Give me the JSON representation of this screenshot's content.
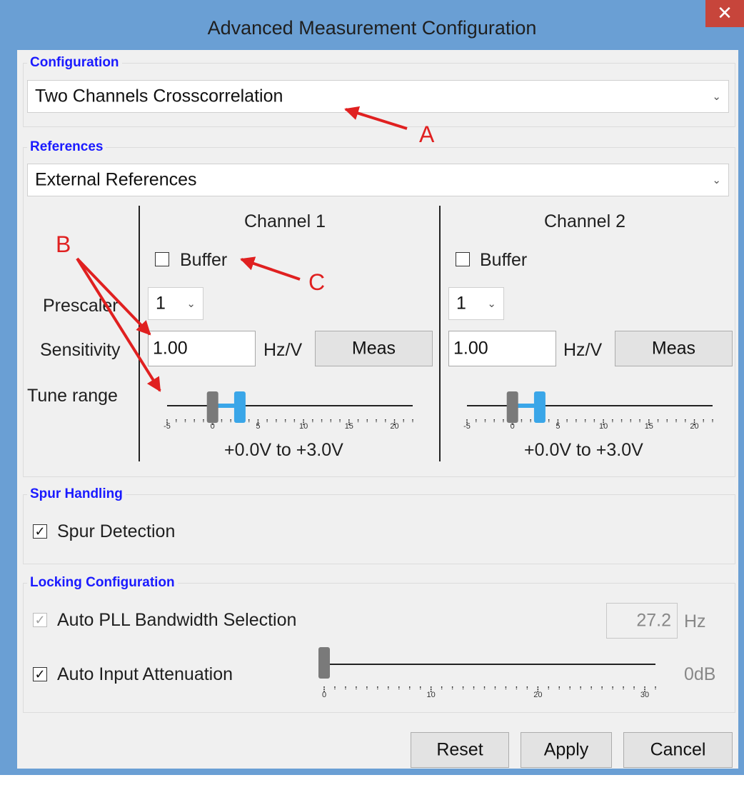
{
  "window": {
    "title": "Advanced Measurement Configuration",
    "close_glyph": "✕"
  },
  "configuration": {
    "legend": "Configuration",
    "selected": "Two Channels Crosscorrelation"
  },
  "references": {
    "legend": "References",
    "selected": "External References",
    "row_labels": {
      "prescaler": "Prescaler",
      "sensitivity": "Sensitivity",
      "tune_range": "Tune range"
    },
    "channels": [
      {
        "title": "Channel 1",
        "buffer_label": "Buffer",
        "buffer_checked": false,
        "prescaler": "1",
        "sensitivity": "1.00",
        "unit": "Hz/V",
        "meas_label": "Meas",
        "tune_low": 0,
        "tune_high": 3,
        "tune_text": "+0.0V to +3.0V"
      },
      {
        "title": "Channel 2",
        "buffer_label": "Buffer",
        "buffer_checked": false,
        "prescaler": "1",
        "sensitivity": "1.00",
        "unit": "Hz/V",
        "meas_label": "Meas",
        "tune_low": 0,
        "tune_high": 3,
        "tune_text": "+0.0V to +3.0V"
      }
    ],
    "tune_scale": {
      "min": -5,
      "max": 22,
      "labels": [
        "-5",
        "0",
        "5",
        "10",
        "15",
        "20"
      ]
    }
  },
  "spur": {
    "legend": "Spur Handling",
    "detection_label": "Spur Detection",
    "detection_checked": true
  },
  "locking": {
    "legend": "Locking Configuration",
    "auto_pll_label": "Auto PLL Bandwidth Selection",
    "auto_pll_checked": true,
    "auto_pll_enabled": false,
    "bandwidth_value": "27.2",
    "bandwidth_unit": "Hz",
    "auto_atten_label": "Auto Input Attenuation",
    "auto_atten_checked": true,
    "atten_value": 0,
    "atten_text": "0dB",
    "atten_scale": {
      "min": 0,
      "max": 31,
      "labels": [
        "0",
        "10",
        "20",
        "30"
      ]
    }
  },
  "buttons": {
    "reset": "Reset",
    "apply": "Apply",
    "cancel": "Cancel"
  },
  "annotations": {
    "a": "A",
    "b": "B",
    "c": "C"
  },
  "colors": {
    "legend": "#1a1aff",
    "titlebar": "#6a9fd4",
    "close": "#c7453b",
    "slider_fill": "#3aa6e8",
    "slider_thumb_low": "#7a7a7a",
    "slider_thumb_high": "#3aa6e8",
    "annotation": "#e02020"
  },
  "icons": {
    "dropdown": "chevron-down-icon",
    "checkmark": "checkmark-icon"
  }
}
